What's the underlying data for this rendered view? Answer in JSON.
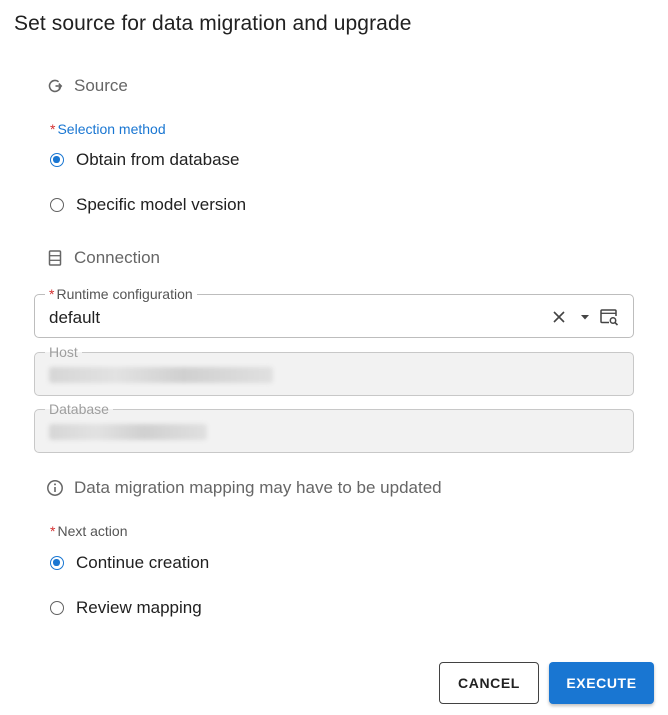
{
  "dialog": {
    "title": "Set source for data migration and upgrade"
  },
  "source": {
    "heading": "Source",
    "icon": "redo-icon",
    "selection_label": "Selection method",
    "options": [
      {
        "label": "Obtain from database",
        "checked": true
      },
      {
        "label": "Specific model version",
        "checked": false
      }
    ]
  },
  "connection": {
    "heading": "Connection",
    "icon": "database-icon",
    "runtime_label": "Runtime configuration",
    "runtime_value": "default",
    "host_label": "Host",
    "database_label": "Database"
  },
  "info": {
    "icon": "info-icon",
    "text": "Data migration mapping may have to be updated"
  },
  "next_action": {
    "label": "Next action",
    "options": [
      {
        "label": "Continue creation",
        "checked": true
      },
      {
        "label": "Review mapping",
        "checked": false
      }
    ]
  },
  "buttons": {
    "cancel": "CANCEL",
    "execute": "EXECUTE"
  },
  "colors": {
    "accent": "#1976d2",
    "required": "#d32f2f"
  }
}
